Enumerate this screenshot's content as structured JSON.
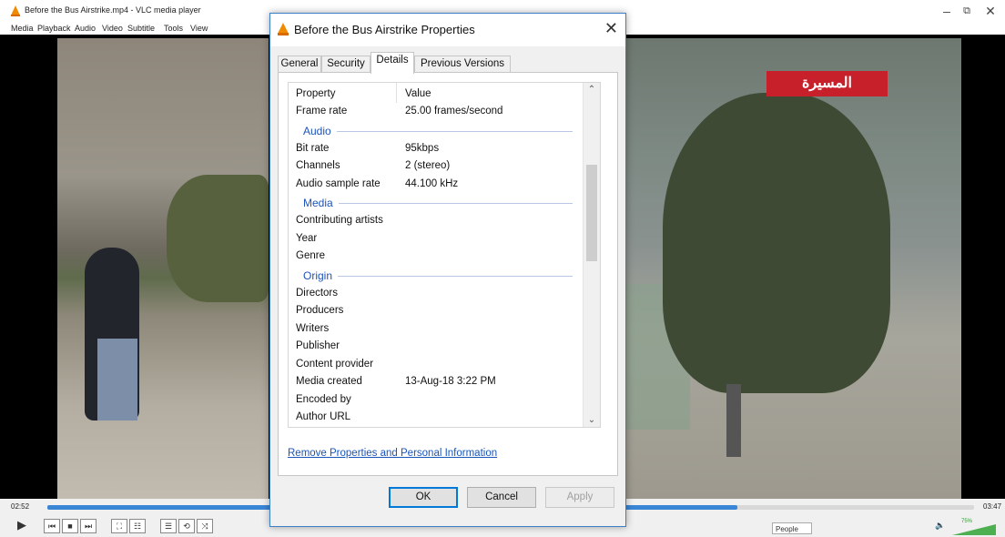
{
  "vlc": {
    "title": "Before the Bus Airstrike.mp4 - VLC media player",
    "menu": [
      "Media",
      "Playback",
      "Audio",
      "Video",
      "Subtitle",
      "Tools",
      "View"
    ],
    "time_elapsed": "02:52",
    "time_total": "03:47",
    "progress": 0.745,
    "people_button": "People",
    "volume_label": "75%",
    "channel_logo_text": "المسيرة",
    "window_controls": {
      "minimize": "–",
      "restore": "⧉",
      "close": "✕"
    }
  },
  "dialog": {
    "title": "Before the Bus Airstrike Properties",
    "close": "✕",
    "tabs": [
      "General",
      "Security",
      "Details",
      "Previous Versions"
    ],
    "active_tab": "Details",
    "columns": {
      "property": "Property",
      "value": "Value"
    },
    "rows": [
      {
        "k": "Frame rate",
        "v": "25.00 frames/second"
      },
      {
        "group": "Audio"
      },
      {
        "k": "Bit rate",
        "v": "95kbps"
      },
      {
        "k": "Channels",
        "v": "2 (stereo)"
      },
      {
        "k": "Audio sample rate",
        "v": "44.100 kHz"
      },
      {
        "group": "Media"
      },
      {
        "k": "Contributing artists",
        "v": ""
      },
      {
        "k": "Year",
        "v": ""
      },
      {
        "k": "Genre",
        "v": ""
      },
      {
        "group": "Origin"
      },
      {
        "k": "Directors",
        "v": ""
      },
      {
        "k": "Producers",
        "v": ""
      },
      {
        "k": "Writers",
        "v": ""
      },
      {
        "k": "Publisher",
        "v": ""
      },
      {
        "k": "Content provider",
        "v": ""
      },
      {
        "k": "Media created",
        "v": "13-Aug-18 3:22 PM"
      },
      {
        "k": "Encoded by",
        "v": ""
      },
      {
        "k": "Author URL",
        "v": ""
      }
    ],
    "link": "Remove Properties and Personal Information",
    "buttons": {
      "ok": "OK",
      "cancel": "Cancel",
      "apply": "Apply"
    }
  },
  "colors": {
    "accent": "#0078d7",
    "group_header": "#1e53b8",
    "seek_fill": "#3a86d6"
  }
}
